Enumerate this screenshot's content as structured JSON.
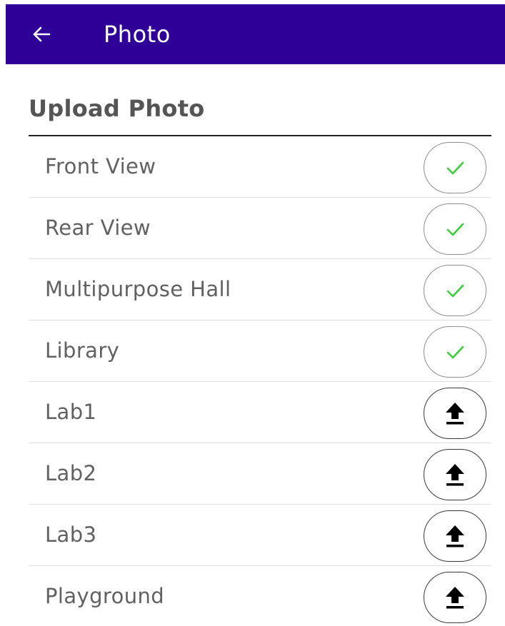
{
  "app_bar": {
    "title": "Photo",
    "back_icon": "arrow-back-icon",
    "background": "#2e0098"
  },
  "section": {
    "title": "Upload Photo"
  },
  "items": [
    {
      "label": "Front View",
      "status": "uploaded",
      "icon": "check-icon"
    },
    {
      "label": "Rear View",
      "status": "uploaded",
      "icon": "check-icon"
    },
    {
      "label": "Multipurpose Hall",
      "status": "uploaded",
      "icon": "check-icon"
    },
    {
      "label": "Library",
      "status": "uploaded",
      "icon": "check-icon"
    },
    {
      "label": "Lab1",
      "status": "pending",
      "icon": "upload-icon"
    },
    {
      "label": "Lab2",
      "status": "pending",
      "icon": "upload-icon"
    },
    {
      "label": "Lab3",
      "status": "pending",
      "icon": "upload-icon"
    },
    {
      "label": "Playground",
      "status": "pending",
      "icon": "upload-icon"
    }
  ],
  "colors": {
    "check": "#3ccc3c",
    "upload": "#000000",
    "label": "#616161"
  }
}
